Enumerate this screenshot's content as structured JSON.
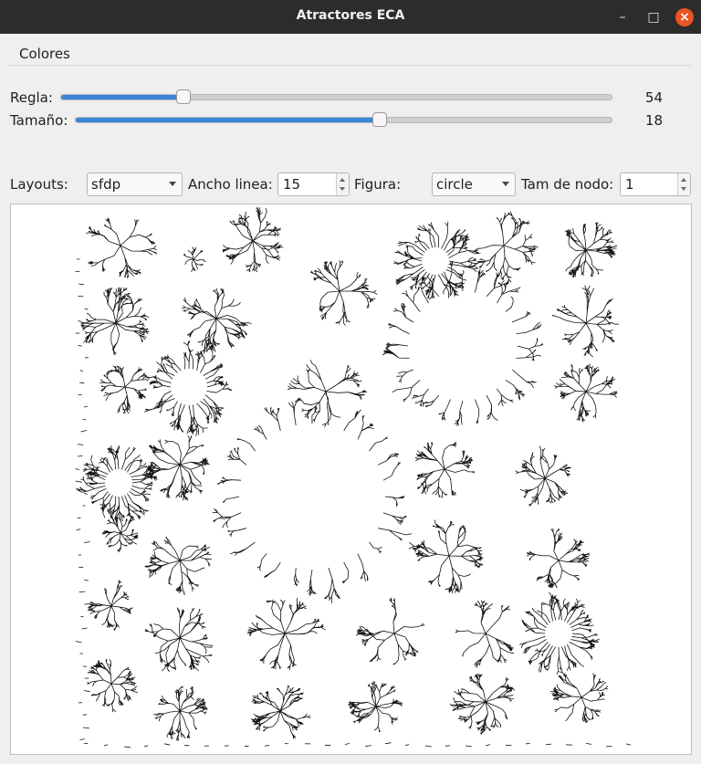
{
  "window": {
    "title": "Atractores ECA",
    "minimize_icon": "minimize-icon",
    "maximize_icon": "maximize-icon",
    "close_icon": "close-icon"
  },
  "menu": {
    "items": [
      {
        "label": "Colores"
      }
    ]
  },
  "controls": {
    "regla": {
      "label": "Regla:",
      "value": "54",
      "fraction": 0.22
    },
    "tamano": {
      "label": "Tamaño:",
      "value": "18",
      "fraction": 0.565
    },
    "layouts": {
      "label": "Layouts:",
      "selected": "sfdp"
    },
    "ancho_linea": {
      "label": "Ancho linea:",
      "value": "15"
    },
    "figura": {
      "label": "Figura:",
      "selected": "circle"
    },
    "tam_nodo": {
      "label": "Tam de nodo:",
      "value": "1"
    }
  },
  "accent_color": "#3b85d6",
  "close_color": "#e95420",
  "graph": {
    "description_icon": "graph-visualization"
  }
}
